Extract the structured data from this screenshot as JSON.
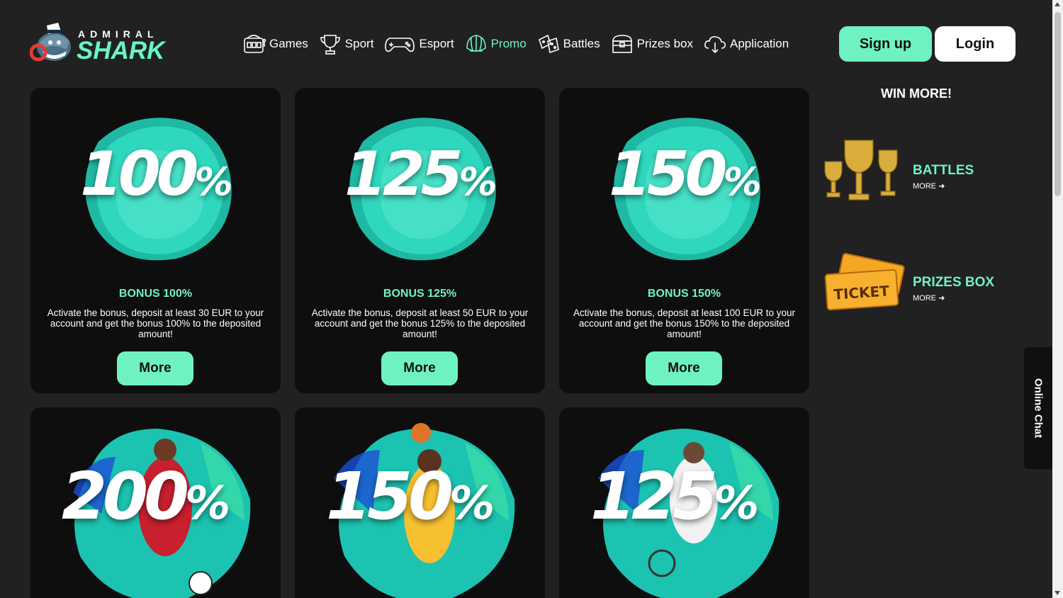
{
  "brand": {
    "top": "ADMIRAL",
    "bottom": "SHARK",
    "accent": "#6ff2c2"
  },
  "nav": [
    {
      "label": "Games",
      "icon": "slot-machine-icon",
      "active": false
    },
    {
      "label": "Sport",
      "icon": "trophy-icon",
      "active": false
    },
    {
      "label": "Esport",
      "icon": "gamepad-icon",
      "active": false
    },
    {
      "label": "Promo",
      "icon": "shell-icon",
      "active": true
    },
    {
      "label": "Battles",
      "icon": "dice-icon",
      "active": false
    },
    {
      "label": "Prizes box",
      "icon": "treasure-chest-icon",
      "active": false
    },
    {
      "label": "Application",
      "icon": "cloud-download-icon",
      "active": false
    }
  ],
  "auth": {
    "signup": "Sign up",
    "login": "Login"
  },
  "promos": [
    {
      "num": "100",
      "pct": "%",
      "title": "BONUS 100%",
      "desc": "Activate the bonus, deposit at least 30 EUR to your account and get the bonus 100% to the deposited amount!",
      "more": "More"
    },
    {
      "num": "125",
      "pct": "%",
      "title": "BONUS 125%",
      "desc": "Activate the bonus, deposit at least 50 EUR to your account and get the bonus 125% to the deposited amount!",
      "more": "More"
    },
    {
      "num": "150",
      "pct": "%",
      "title": "BONUS 150%",
      "desc": "Activate the bonus, deposit at least 100 EUR to your account and get the bonus 150% to the deposited amount!",
      "more": "More"
    }
  ],
  "sport_promos": [
    {
      "num": "200",
      "pct": "%",
      "icon": "football-player-icon"
    },
    {
      "num": "150",
      "pct": "%",
      "icon": "basketball-player-icon"
    },
    {
      "num": "125",
      "pct": "%",
      "icon": "tennis-player-icon"
    }
  ],
  "sidebar": {
    "heading": "WIN MORE!",
    "items": [
      {
        "label": "BATTLES",
        "link": "MORE",
        "icon": "trophies-icon"
      },
      {
        "label": "PRIZES BOX",
        "link": "MORE",
        "icon": "ticket-icon",
        "ticket_text": "TICKET"
      }
    ]
  },
  "chat": {
    "label": "Online Chat"
  }
}
